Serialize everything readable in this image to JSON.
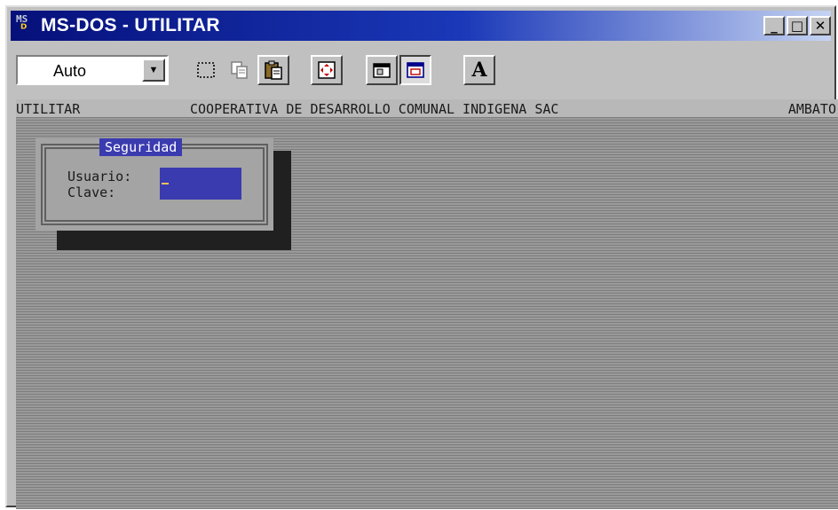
{
  "window": {
    "title": "MS-DOS - UTILITAR",
    "icon_top": "MS",
    "icon_bottom": "DOS"
  },
  "controls": {
    "minimize": "_",
    "maximize": "□",
    "close": "✕"
  },
  "toolbar": {
    "font_value": "Auto",
    "tools": [
      {
        "name": "mark-icon"
      },
      {
        "name": "copy-icon"
      },
      {
        "name": "paste-icon"
      },
      {
        "name": "fullscreen-icon"
      },
      {
        "name": "properties-icon"
      },
      {
        "name": "background-icon"
      },
      {
        "name": "font-icon",
        "label": "A"
      }
    ]
  },
  "dos": {
    "header_left": "UTILITAR",
    "header_center": "COOPERATIVA DE DESARROLLO COMUNAL INDIGENA SAC",
    "header_right": "AMBATO",
    "dialog": {
      "title": "Seguridad",
      "user_label": "Usuario:",
      "password_label": "Clave:"
    }
  },
  "colors": {
    "titlebar_start": "#06107a",
    "titlebar_end": "#c5d3f2",
    "dialog_title_bg": "#3b3bb0",
    "input_bg": "#3b3bb0"
  }
}
